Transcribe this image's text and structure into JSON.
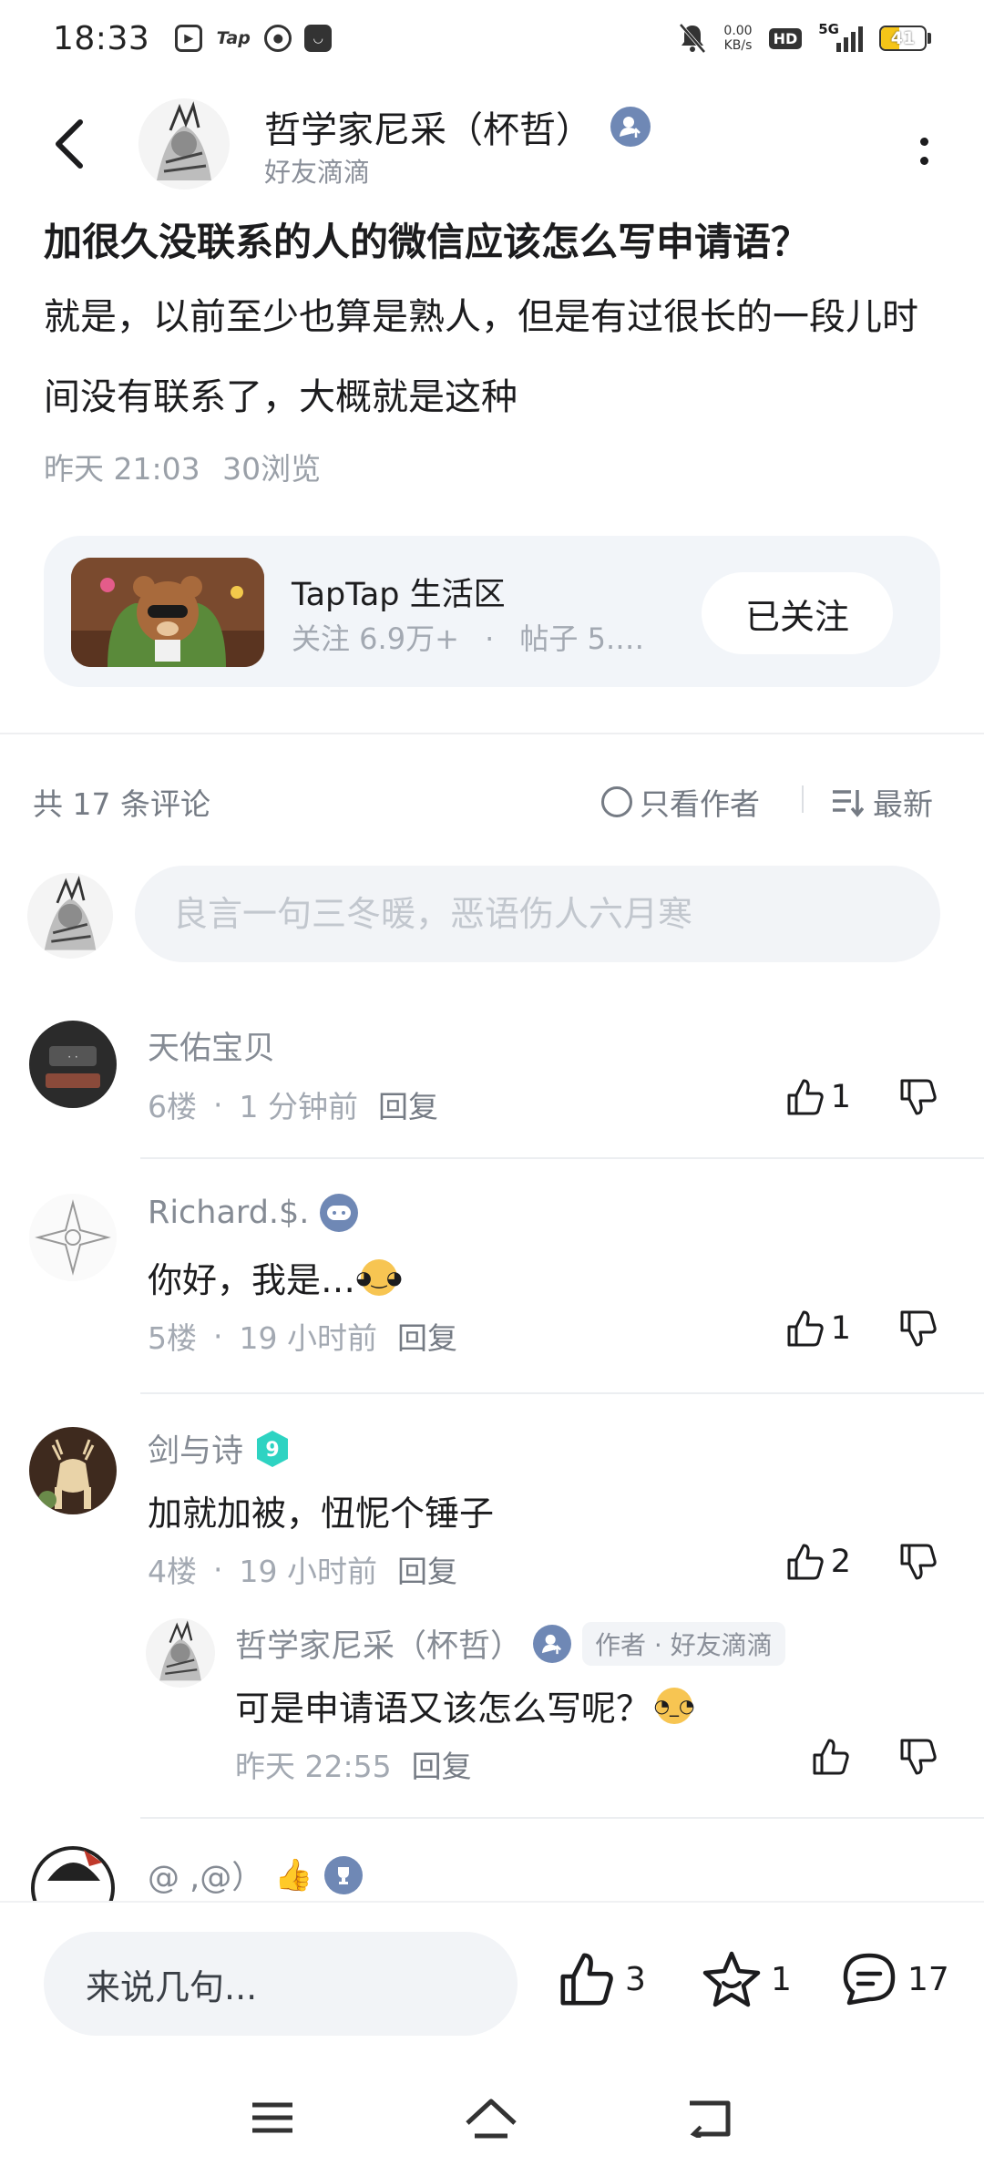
{
  "status_bar": {
    "time": "18:33",
    "app_icons": [
      "bilibili-icon",
      "taptap-icon",
      "baidu-icon",
      "dark-app-icon"
    ],
    "taptap_text": "Tap",
    "network_speed_value": "0.00",
    "network_speed_unit": "KB/s",
    "hd_label": "HD",
    "network_label": "5G",
    "battery_level": "41",
    "battery_color": "#f5c518"
  },
  "header": {
    "author_name": "哲学家尼采（杯哲）",
    "author_subtitle": "好友滴滴"
  },
  "post": {
    "title": "加很久没联系的人的微信应该怎么写申请语？",
    "body": "就是，以前至少也算是熟人，但是有过很长的一段儿时间没有联系了，大概就是这种",
    "time": "昨天 21:03",
    "views": "30浏览"
  },
  "community": {
    "name": "TapTap 生活区",
    "followers": "关注 6.9万+",
    "separator": "·",
    "posts": "帖子 5.…",
    "follow_label": "已关注"
  },
  "comments_bar": {
    "count_label": "共 17 条评论",
    "only_author_label": "只看作者",
    "sort_label": "最新"
  },
  "comment_input": {
    "placeholder": "良言一句三冬暖，恶语伤人六月寒"
  },
  "comments": [
    {
      "name": "天佑宝贝",
      "floor": "6楼",
      "time": "1 分钟前",
      "reply_label": "回复",
      "likes": "1"
    },
    {
      "name": "Richard.$.",
      "text": "你好，我是…",
      "floor": "5楼",
      "time": "19 小时前",
      "reply_label": "回复",
      "likes": "1"
    },
    {
      "name": "剑与诗",
      "level_badge": "9",
      "text": "加就加被，忸怩个锤子",
      "floor": "4楼",
      "time": "19 小时前",
      "reply_label": "回复",
      "likes": "2",
      "reply": {
        "name": "哲学家尼采（杯哲）",
        "tag": "作者 · 好友滴滴",
        "text": "可是申请语又该怎么写呢？",
        "time": "昨天 22:55",
        "reply_label": "回复"
      }
    },
    {
      "name": "@ ,@）"
    }
  ],
  "bottom_bar": {
    "input_label": "来说几句...",
    "likes": "3",
    "favorites": "1",
    "comments": "17"
  }
}
